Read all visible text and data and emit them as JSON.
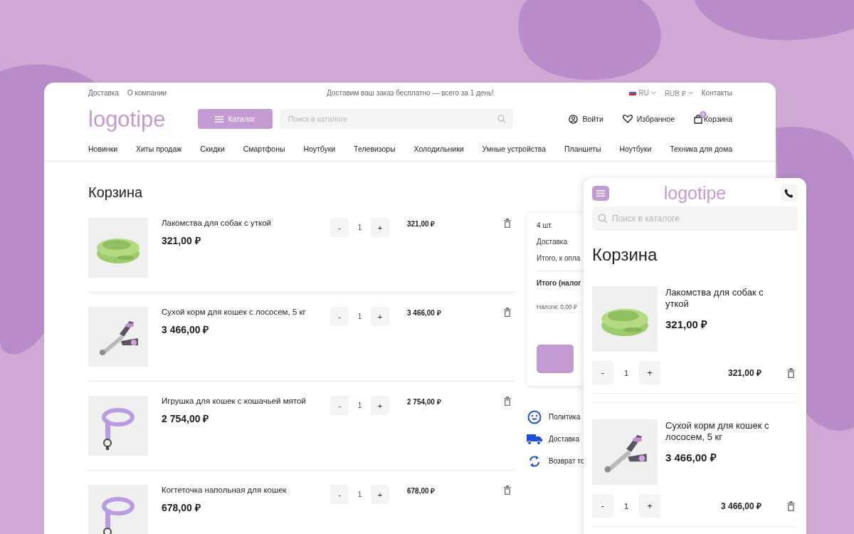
{
  "desktop": {
    "top_links": [
      "Доставка",
      "О компании"
    ],
    "promo": "Доставим ваш заказ бесплатно — всего за 1 день!",
    "language": "RU",
    "currency": "RUB ₽",
    "contacts": "Контакты",
    "logo": "logotipe",
    "catalog_button": "Каталог",
    "search": {
      "placeholder": "Поиск в каталоге"
    },
    "actions": [
      {
        "kind": "login",
        "label": "Войти"
      },
      {
        "kind": "favorites",
        "label": "Избранное"
      },
      {
        "kind": "cart",
        "label": "Корзина",
        "badge": "4"
      }
    ],
    "nav": [
      "Новинки",
      "Хиты продаж",
      "Скидки",
      "Смартфоны",
      "Ноутбуки",
      "Телевизоры",
      "Холодильники",
      "Умные устройства",
      "Планшеты",
      "Ноутбуки",
      "Техника для дома"
    ],
    "title": "Корзина",
    "items": [
      {
        "name": "Лакомства для собак с уткой",
        "price": "321,00 ₽",
        "minus": "-",
        "quantity": "1",
        "plus": "+",
        "total": "321,00 ₽"
      },
      {
        "name": "Сухой корм для кошек с лососем, 5 кг",
        "price": "3 466,00 ₽",
        "minus": "-",
        "quantity": "1",
        "plus": "+",
        "total": "3 466,00 ₽"
      },
      {
        "name": "Игрушка для кошек с кошачьей мятой",
        "price": "2 754,00 ₽",
        "minus": "-",
        "quantity": "1",
        "plus": "+",
        "total": "2 754,00 ₽"
      },
      {
        "name": "Когтеточка напольная для кошек",
        "price": "678,00 ₽",
        "minus": "-",
        "quantity": "1",
        "plus": "+",
        "total": "678,00 ₽"
      }
    ],
    "summary": {
      "lines": [
        {
          "kind": "plain",
          "label": "4 шт."
        },
        {
          "kind": "plain",
          "label": "Доставка"
        },
        {
          "kind": "plain",
          "label": "Итого, к опла"
        },
        {
          "kind": "bold",
          "label": "Итого (налог"
        },
        {
          "kind": "small",
          "label": "Налоги: 0,00 ₽"
        }
      ]
    },
    "info_links": [
      {
        "kind": "policy",
        "label": "Политика"
      },
      {
        "kind": "delivery",
        "label": "Доставка"
      },
      {
        "kind": "returns",
        "label": "Возврат то"
      }
    ]
  },
  "mobile": {
    "logo": "logotipe",
    "search": {
      "placeholder": "Поиск в каталоге"
    },
    "title": "Корзина",
    "items": [
      {
        "name": "Лакомства для собак с уткой",
        "price": "321,00 ₽",
        "minus": "-",
        "quantity": "1",
        "plus": "+",
        "total": "321,00 ₽"
      },
      {
        "name": "Сухой корм для кошек с лососем, 5 кг",
        "price": "3 466,00 ₽",
        "minus": "-",
        "quantity": "1",
        "plus": "+",
        "total": "3 466,00 ₽"
      }
    ]
  }
}
